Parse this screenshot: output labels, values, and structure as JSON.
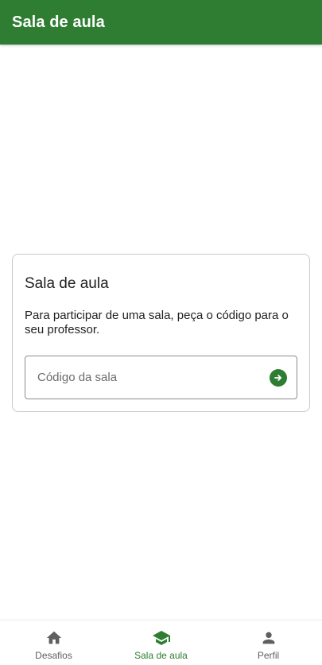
{
  "appbar": {
    "title": "Sala de aula"
  },
  "card": {
    "title": "Sala de aula",
    "description": "Para participar de uma sala, peça o código para o seu professor.",
    "code_field": {
      "placeholder": "Código da sala",
      "value": "",
      "submit_icon": "arrow-right-circle-icon"
    }
  },
  "bottom_nav": {
    "items": [
      {
        "label": "Desafios",
        "icon": "home-icon",
        "active": false
      },
      {
        "label": "Sala de aula",
        "icon": "graduation-cap-icon",
        "active": true
      },
      {
        "label": "Perfil",
        "icon": "person-icon",
        "active": false
      }
    ]
  },
  "colors": {
    "primary": "#2e7d32",
    "nav_inactive": "#5f5f5f",
    "text": "#1f1f1f",
    "background": "#ffffff"
  }
}
